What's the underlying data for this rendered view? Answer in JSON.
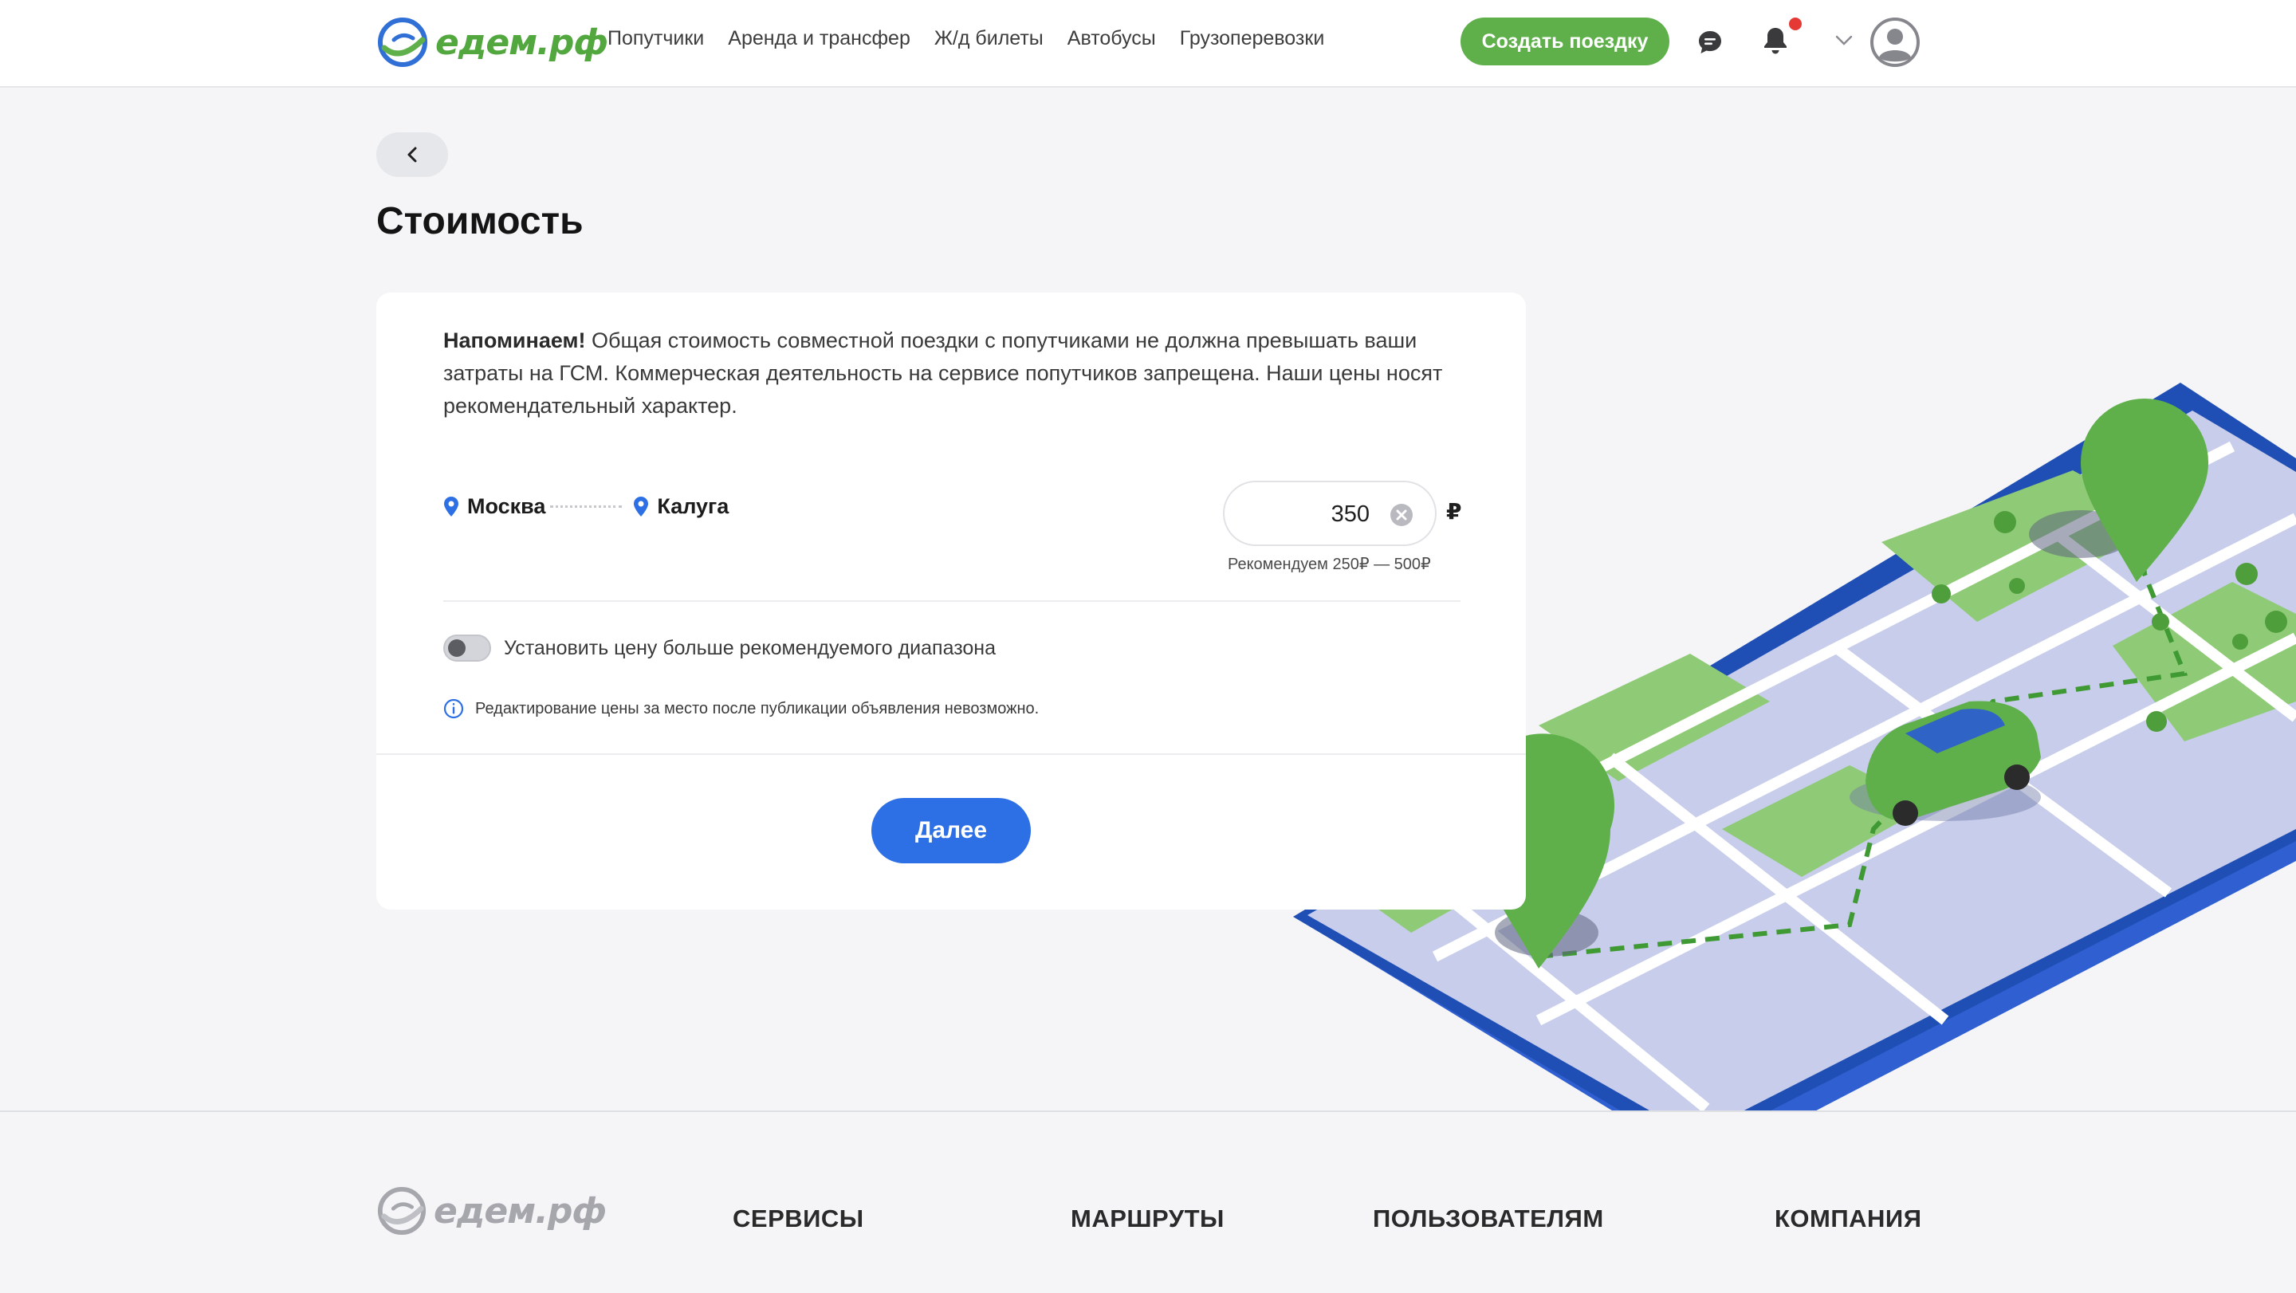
{
  "header": {
    "logo_text": "едем.рф",
    "nav": [
      "Попутчики",
      "Аренда и трансфер",
      "Ж/д билеты",
      "Автобусы",
      "Грузоперевозки"
    ],
    "create_trip": "Создать поездку"
  },
  "page": {
    "title": "Стоимость"
  },
  "card": {
    "notice_bold": "Напоминаем!",
    "notice_text": " Общая стоимость совместной поездки с попутчиками не должна превышать ваши затраты на ГСМ. Коммерческая деятельность на сервисе попутчиков запрещена. Наши цены носят рекомендательный характер.",
    "route_from": "Москва",
    "route_to": "Калуга",
    "price": "350",
    "currency": "₽",
    "recommend": "Рекомендуем 250₽ — 500₽",
    "toggle_label": "Установить цену больше рекомендуемого диапазона",
    "toggle_on": false,
    "info_text": "Редактирование цены за место после публикации объявления невозможно.",
    "next_button": "Далее"
  },
  "footer": {
    "logo_text": "едем.рф",
    "columns": [
      "СЕРВИСЫ",
      "МАРШРУТЫ",
      "ПОЛЬЗОВАТЕЛЯМ",
      "КОМПАНИЯ"
    ]
  },
  "colors": {
    "brand_green": "#5fb04b",
    "primary_blue": "#2d6fe4",
    "notification": "#e53935"
  }
}
